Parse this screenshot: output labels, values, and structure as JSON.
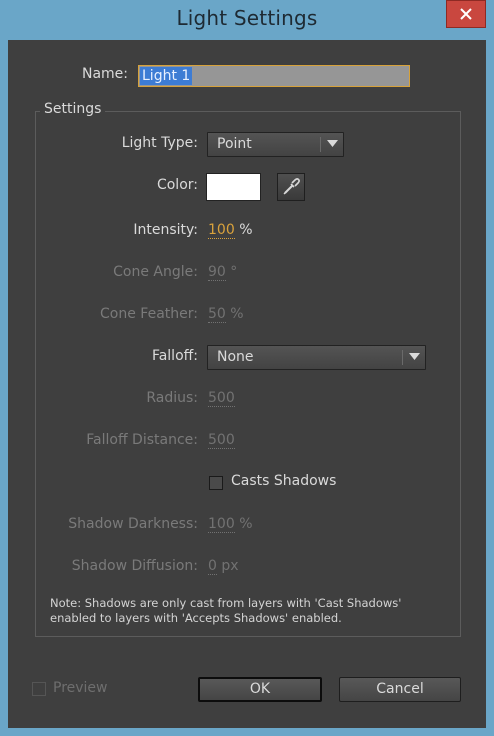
{
  "window": {
    "title": "Light Settings"
  },
  "name": {
    "label": "Name:",
    "value": "Light 1"
  },
  "settings": {
    "group_title": "Settings",
    "light_type": {
      "label": "Light Type:",
      "value": "Point"
    },
    "color": {
      "label": "Color:",
      "swatch": "#ffffff"
    },
    "intensity": {
      "label": "Intensity:",
      "value": "100",
      "unit": "%",
      "value_color": "#d9a23c"
    },
    "cone_angle": {
      "label": "Cone Angle:",
      "value": "90",
      "unit": "°"
    },
    "cone_feather": {
      "label": "Cone Feather:",
      "value": "50",
      "unit": "%"
    },
    "falloff": {
      "label": "Falloff:",
      "value": "None"
    },
    "radius": {
      "label": "Radius:",
      "value": "500"
    },
    "falloff_distance": {
      "label": "Falloff Distance:",
      "value": "500"
    },
    "casts_shadows": {
      "label": "Casts Shadows",
      "checked": false
    },
    "shadow_darkness": {
      "label": "Shadow Darkness:",
      "value": "100",
      "unit": "%"
    },
    "shadow_diffusion": {
      "label": "Shadow Diffusion:",
      "value": "0",
      "unit": "px"
    },
    "note": "Note: Shadows are only cast from layers with 'Cast Shadows' enabled to layers with 'Accepts Shadows' enabled."
  },
  "footer": {
    "preview_label": "Preview",
    "ok_label": "OK",
    "cancel_label": "Cancel"
  },
  "icons": {
    "close": "close-icon",
    "eyedropper": "eyedropper-icon",
    "dropdown": "chevron-down-icon"
  }
}
